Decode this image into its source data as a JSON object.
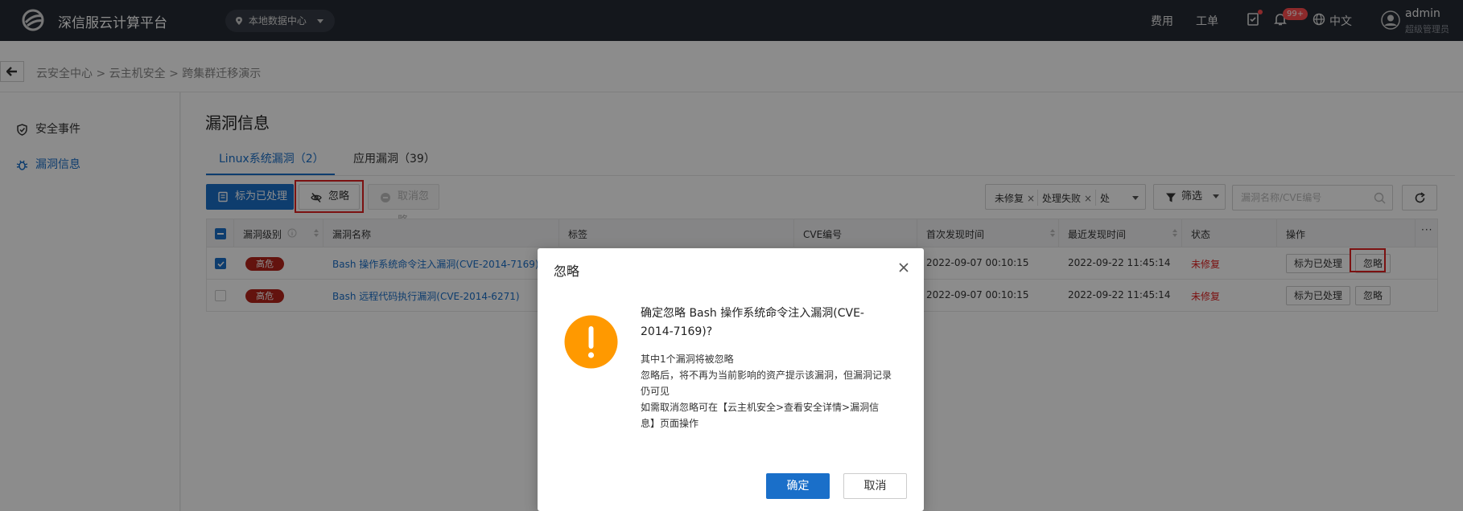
{
  "topbar": {
    "brand": "深信服云计算平台",
    "datacenter": "本地数据中心",
    "nav": {
      "cost": "费用",
      "ticket": "工单"
    },
    "notification_count": "99+",
    "language": "中文",
    "user": {
      "name": "admin",
      "role": "超级管理员"
    }
  },
  "breadcrumb": {
    "text": "云安全中心 > 云主机安全 > 跨集群迁移演示"
  },
  "sidebar": {
    "items": [
      {
        "label": "安全事件",
        "icon": "shield-check-icon"
      },
      {
        "label": "漏洞信息",
        "icon": "bug-icon",
        "active": true
      }
    ]
  },
  "main": {
    "title": "漏洞信息",
    "tabs": [
      {
        "label": "Linux系统漏洞（2）",
        "active": true
      },
      {
        "label": "应用漏洞（39）"
      }
    ],
    "toolbar": {
      "mark_processed": "标为已处理",
      "ignore": "忽略",
      "cancel_ignore": "取消忽略",
      "filters": [
        "未修复",
        "处理失败",
        "处"
      ],
      "filter_button": "筛选",
      "search_placeholder": "漏洞名称/CVE编号"
    },
    "table": {
      "columns": [
        "漏洞级别",
        "漏洞名称",
        "标签",
        "CVE编号",
        "首次发现时间",
        "最近发现时间",
        "状态",
        "操作"
      ],
      "rows": [
        {
          "checked": true,
          "severity": "高危",
          "name": "Bash 操作系统命令注入漏洞(CVE-2014-7169)",
          "first_seen": "2022-09-07 00:10:15",
          "last_seen": "2022-09-22 11:45:14",
          "status": "未修复",
          "op_mark": "标为已处理",
          "op_ignore": "忽略"
        },
        {
          "checked": false,
          "severity": "高危",
          "name": "Bash 远程代码执行漏洞(CVE-2014-6271)",
          "first_seen": "2022-09-07 00:10:15",
          "last_seen": "2022-09-22 11:45:14",
          "status": "未修复",
          "op_mark": "标为已处理",
          "op_ignore": "忽略"
        }
      ]
    }
  },
  "modal": {
    "title": "忽略",
    "question_line1": "确定忽略 Bash 操作系统命令注入漏洞(CVE-",
    "question_line2": "2014-7169)?",
    "info_lines": [
      "其中1个漏洞将被忽略",
      "忽略后，将不再为当前影响的资产提示该漏洞，但漏洞记录",
      "仍可见",
      "如需取消忽略可在【云主机安全>查看安全详情>漏洞信",
      "息】页面操作"
    ],
    "confirm": "确定",
    "cancel": "取消"
  },
  "colors": {
    "primary": "#1a6fc9",
    "danger": "#e02020",
    "severity_high": "#b4231a",
    "warning": "#ff9900",
    "topbar": "#262b34"
  }
}
